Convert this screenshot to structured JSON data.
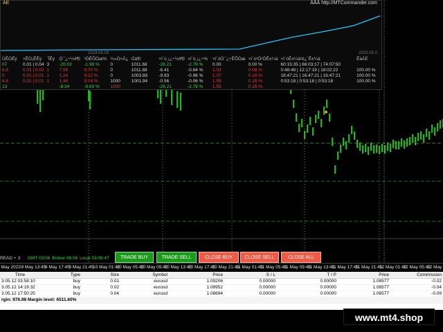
{
  "panel": {
    "title": "AE",
    "brand": "ÄÃÄ http://MTCommander.com",
    "date_left": "2023.05.03",
    "date_right": "2023.05.0",
    "headers": [
      "ÜÊÓÊý",
      "×ÊÓ¡ÊÊý",
      "´ÎÊý",
      "Ó¯¿÷½ð¶î",
      "³ÓÊÕÒæ%",
      "½»Ò×Á¿",
      "Óà¶î",
      "×î´ó¸¡¿÷½ð¶î",
      "×î´ó¸¡¿÷%",
      "×î´óÓ¯¿÷ÊÕÒæ",
      "×î´ó³Ö²ÖÊ±¼ä",
      "×î´óÊ±¼ä²é¿´Ê±¼ä",
      "ÊäÁË"
    ],
    "rows": [
      [
        "07",
        "0.01 | 0.04",
        "3",
        "-20.02",
        "-1.98 %",
        "0",
        "1011.68",
        "-28.21",
        "-2.79 %",
        "0.00",
        "0.00 %",
        "60:15:35 | 66:03:17 | 74:07:50",
        ""
      ],
      [
        "6.8",
        "0.01 | 0.02",
        "1",
        "7.99",
        "0.70 %",
        "0",
        "1011.88",
        "-6.41",
        "-0.64 %",
        "1.02",
        "0.08 %",
        "0:48:48 | 12:17:19 | 18:02:22",
        "100.00 %"
      ],
      [
        "0",
        "0.01 | 0.01",
        "1",
        "1.24",
        "0.12 %",
        "0",
        "1003.88",
        "-9.83",
        "-0.96 %",
        "1.07",
        "0.10 %",
        "16:47:21 | 16:47:21 | 16:47:21",
        "100.00 %"
      ],
      [
        "8.8",
        "0.01 | 0.01",
        "1",
        "1.44",
        "0.14 %",
        "1000",
        "1001.94",
        "-0.56",
        "-0.06 %",
        "1.55",
        "0.15 %",
        "0:53:18 | 0:53:18 | 0:53:18",
        "100.00 %"
      ],
      [
        "13",
        "",
        "",
        "-8.34",
        "-0.83 %",
        "1000",
        "",
        "-28.21",
        "-2.79 %",
        "1.55",
        "0.15 %",
        "",
        ""
      ]
    ]
  },
  "status": {
    "left": "READ + 3",
    "gmt": "GMT 03:06",
    "broker": "Broker 06:06",
    "local": "Local 03:06:47"
  },
  "buttons": {
    "trade_buy": "TRADE BUY",
    "trade_sell": "TRADE SELL",
    "close_buy": "CLOSE BUY",
    "close_sell": "CLOSE SELL",
    "close_all": "CLOSE ALL"
  },
  "time_axis": [
    "9 May 2023",
    "9 May 13:45",
    "9 May 17:45",
    "9 May 21:45",
    "10 May 01:45",
    "10 May 05:45",
    "10 May 09:45",
    "10 May 13:45",
    "10 May 17:45",
    "10 May 21:45",
    "11 May 01:45",
    "11 May 05:45",
    "11 May 09:45",
    "11 May 13:45",
    "11 May 17:45",
    "11 May 21:45",
    "12 May 01:45",
    "12 May 05:45",
    "12 May 09:45"
  ],
  "terminal": {
    "columns": [
      "Time",
      "Type",
      "Size",
      "Symbol",
      "Price",
      "S / L",
      "T / P",
      "Price",
      "Commission"
    ],
    "rows": [
      [
        "3.05.12 03:58:10",
        "buy",
        "0.01",
        "eurusd",
        "1.09206",
        "0.00000",
        "0.00000",
        "1.08577",
        "-0.02"
      ],
      [
        "3.05.12 14:19:32",
        "buy",
        "0.02",
        "eurusd",
        "1.08952",
        "0.00000",
        "0.00000",
        "1.08577",
        "-0.04"
      ],
      [
        "3.05.12 17:50:25",
        "buy",
        "0.04",
        "eurusd",
        "1.08694",
        "0.00000",
        "0.00000",
        "1.08577",
        "-0.09"
      ]
    ],
    "balance_line": "rgin: 976.98  Margin level: 6511.60%"
  },
  "watermark": "www.mt4.shop",
  "colors": {
    "candle_up": "#00ff00",
    "equity_line": "#1ec8ff",
    "grid": "#c8c8c8",
    "level_line": "#3d8f3d",
    "buy_button": "#1b9b1b",
    "close_button": "#f05a45"
  }
}
